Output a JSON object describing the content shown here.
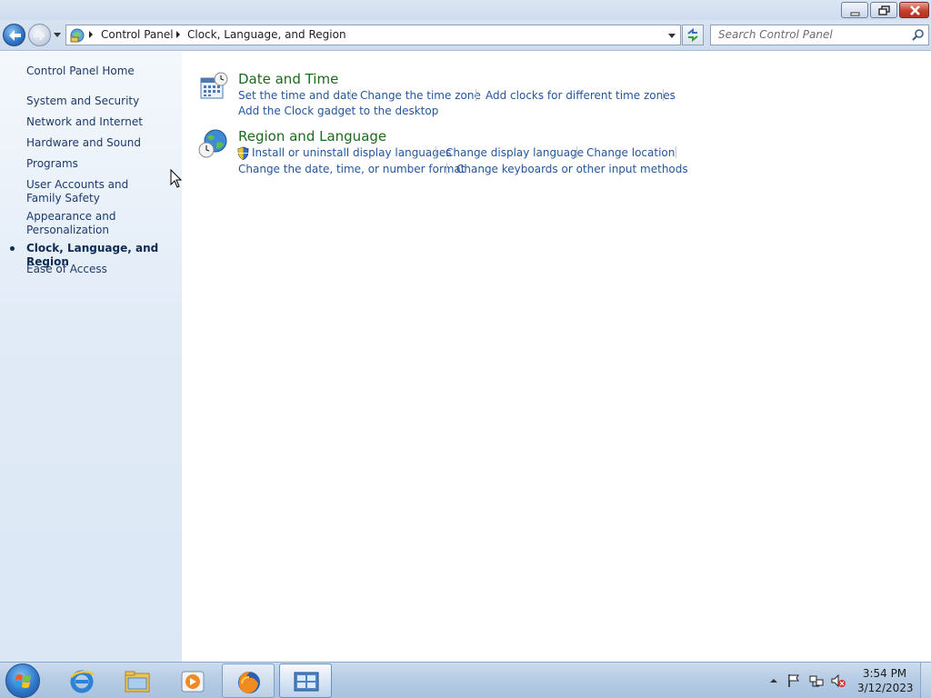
{
  "window": {
    "buttons": {
      "minimize": "minimize",
      "maximize": "restore",
      "close": "close"
    }
  },
  "address_bar": {
    "crumbs": [
      "Control Panel",
      "Clock, Language, and Region"
    ]
  },
  "search": {
    "placeholder": "Search Control Panel"
  },
  "left_nav": {
    "home": "Control Panel Home",
    "items": [
      {
        "label": "System and Security"
      },
      {
        "label": "Network and Internet"
      },
      {
        "label": "Hardware and Sound"
      },
      {
        "label": "Programs"
      },
      {
        "label": "User Accounts and Family Safety"
      },
      {
        "label": "Appearance and Personalization"
      },
      {
        "label": "Clock, Language, and Region",
        "current": true
      },
      {
        "label": "Ease of Access"
      }
    ]
  },
  "categories": [
    {
      "title": "Date and Time",
      "icon": "calendar-clock-icon",
      "tasks": [
        "Set the time and date",
        "Change the time zone",
        "Add clocks for different time zones",
        "Add the Clock gadget to the desktop"
      ]
    },
    {
      "title": "Region and Language",
      "icon": "globe-clock-icon",
      "tasks": [
        "Install or uninstall display languages",
        "Change display language",
        "Change location",
        "Change the date, time, or number format",
        "Change keyboards or other input methods"
      ]
    }
  ],
  "taskbar": {
    "apps": [
      "Internet Explorer",
      "Windows Explorer",
      "Windows Media Player",
      "Firefox",
      "Control Panel"
    ],
    "clock": {
      "time": "3:54 PM",
      "date": "3/12/2023"
    }
  },
  "colors": {
    "link": "#23569e",
    "category_title": "#1d6a1d",
    "left_pane": "#dbe7f5"
  }
}
